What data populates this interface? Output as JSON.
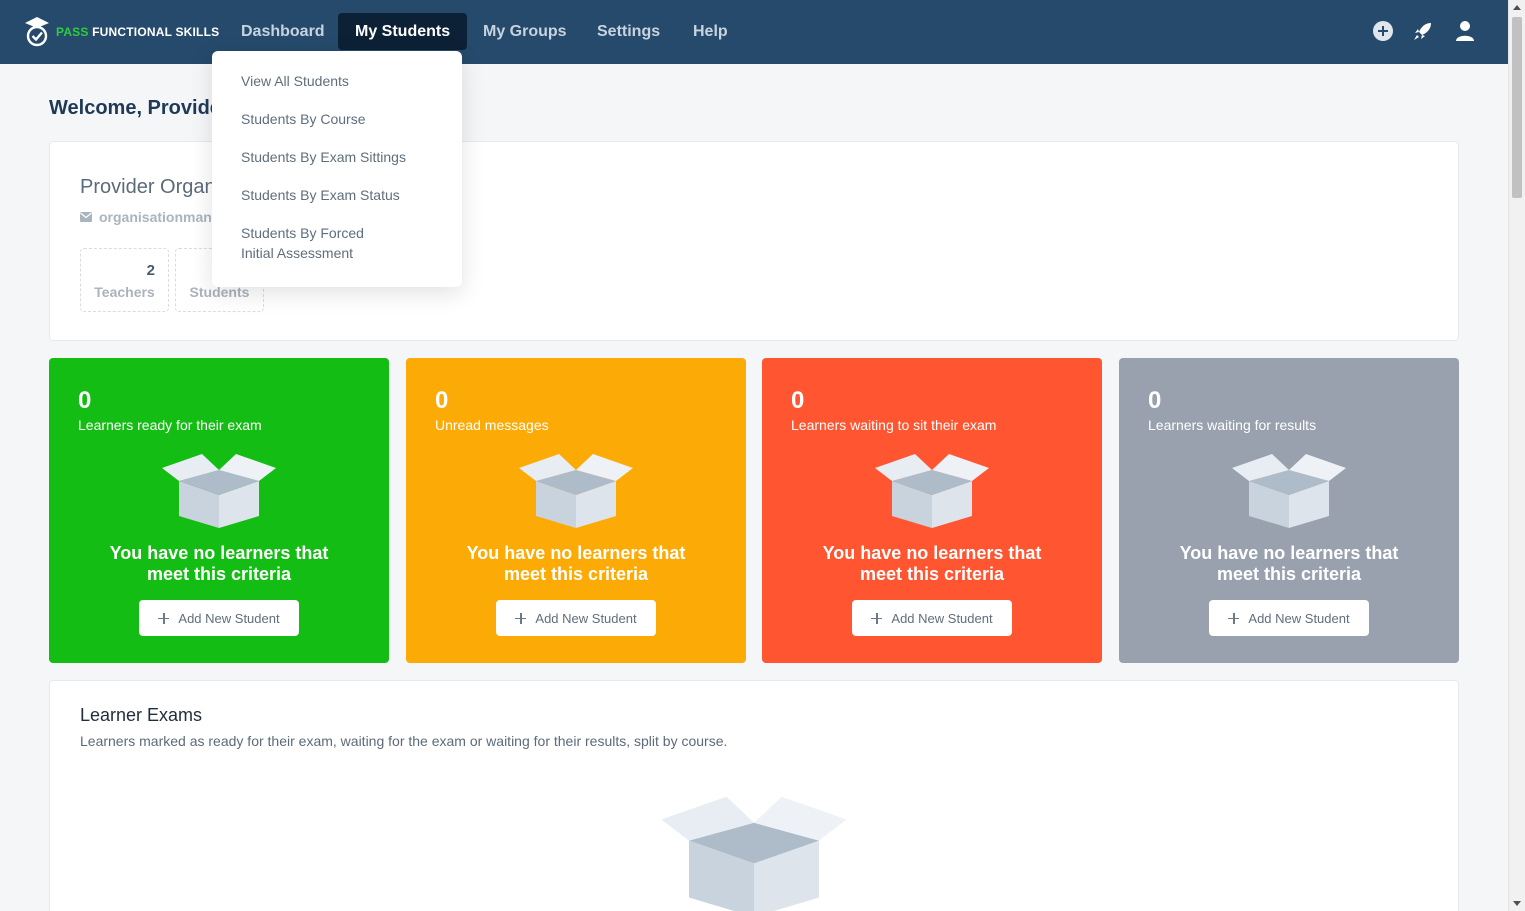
{
  "brand": {
    "pass": "PASS",
    "rest": "FUNCTIONAL SKILLS"
  },
  "nav": {
    "items": [
      "Dashboard",
      "My Students",
      "My Groups",
      "Settings",
      "Help"
    ],
    "active": "My Students",
    "icons": [
      "plus-circle-icon",
      "rocket-icon",
      "user-icon"
    ]
  },
  "dropdown": {
    "items": [
      "View All Students",
      "Students By Course",
      "Students By Exam Sittings",
      "Students By Exam Status",
      "Students By Forced Initial Assessment"
    ]
  },
  "welcome": "Welcome, Provide",
  "org": {
    "name": "Provider Organ",
    "email": "organisationmana",
    "stats": [
      {
        "value": "2",
        "label": "Teachers"
      },
      {
        "value": "",
        "label": "Students"
      }
    ]
  },
  "tiles": [
    {
      "count": "0",
      "label": "Learners ready for their exam",
      "empty": "You have no learners that meet this criteria",
      "button": "Add New Student",
      "color": "#14bd14"
    },
    {
      "count": "0",
      "label": "Unread messages",
      "empty": "You have no learners that meet this criteria",
      "button": "Add New Student",
      "color": "#fcaa06"
    },
    {
      "count": "0",
      "label": "Learners waiting to sit their exam",
      "empty": "You have no learners that meet this criteria",
      "button": "Add New Student",
      "color": "#ff5530"
    },
    {
      "count": "0",
      "label": "Learners waiting for results",
      "empty": "You have no learners that meet this criteria",
      "button": "Add New Student",
      "color": "#98a1ad"
    }
  ],
  "exams": {
    "title": "Learner Exams",
    "subtitle": "Learners marked as ready for their exam, waiting for the exam or waiting for their results, split by course."
  }
}
